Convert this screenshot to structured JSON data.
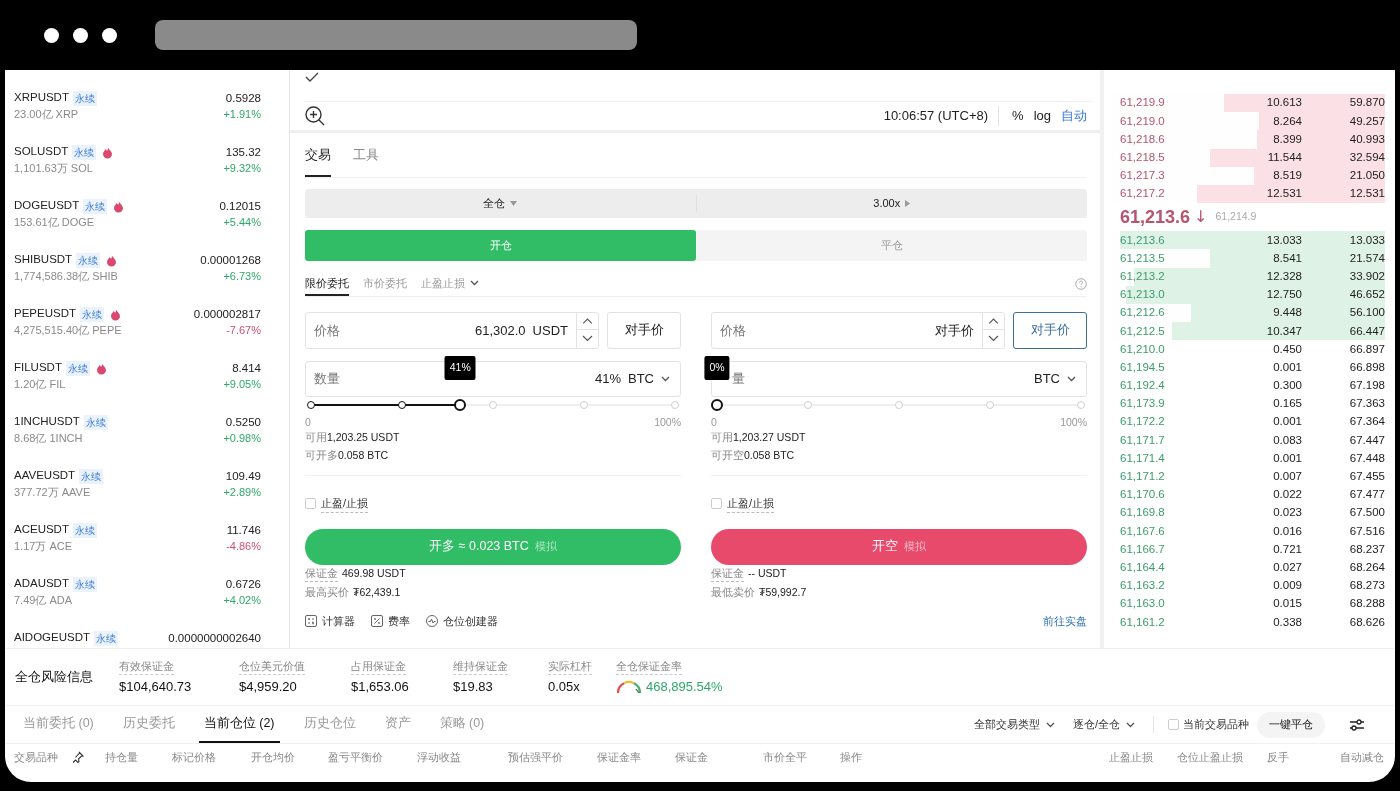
{
  "markets": [
    {
      "symbol": "XRPUSDT",
      "tag": "永续",
      "hot": false,
      "volume": "23.00亿 XRP",
      "price": "0.5928",
      "change": "+1.91%",
      "color": "#2fa86a"
    },
    {
      "symbol": "SOLUSDT",
      "tag": "永续",
      "hot": true,
      "volume": "1,101.63万 SOL",
      "price": "135.32",
      "change": "+9.32%",
      "color": "#2fa86a"
    },
    {
      "symbol": "DOGEUSDT",
      "tag": "永续",
      "hot": true,
      "volume": "153.61亿 DOGE",
      "price": "0.12015",
      "change": "+5.44%",
      "color": "#2fa86a"
    },
    {
      "symbol": "SHIBUSDT",
      "tag": "永续",
      "hot": true,
      "volume": "1,774,586.38亿 SHIB",
      "price": "0.00001268",
      "change": "+6.73%",
      "color": "#2fa86a"
    },
    {
      "symbol": "PEPEUSDT",
      "tag": "永续",
      "hot": true,
      "volume": "4,275,515.40亿 PEPE",
      "price": "0.000002817",
      "change": "-7.67%",
      "color": "#c9506e"
    },
    {
      "symbol": "FILUSDT",
      "tag": "永续",
      "hot": true,
      "volume": "1.20亿 FIL",
      "price": "8.414",
      "change": "+9.05%",
      "color": "#2fa86a"
    },
    {
      "symbol": "1INCHUSDT",
      "tag": "永续",
      "hot": false,
      "volume": "8.68亿 1INCH",
      "price": "0.5250",
      "change": "+0.98%",
      "color": "#2fa86a"
    },
    {
      "symbol": "AAVEUSDT",
      "tag": "永续",
      "hot": false,
      "volume": "377.72万 AAVE",
      "price": "109.49",
      "change": "+2.89%",
      "color": "#2fa86a"
    },
    {
      "symbol": "ACEUSDT",
      "tag": "永续",
      "hot": false,
      "volume": "1.17万 ACE",
      "price": "11.746",
      "change": "-4.86%",
      "color": "#c9506e"
    },
    {
      "symbol": "ADAUSDT",
      "tag": "永续",
      "hot": false,
      "volume": "7.49亿 ADA",
      "price": "0.6726",
      "change": "+4.02%",
      "color": "#2fa86a"
    },
    {
      "symbol": "AIDOGEUSDT",
      "tag": "永续",
      "hot": false,
      "price": "0.0000000002640"
    }
  ],
  "chart_toolbar": {
    "time": "10:06:57 (UTC+8)",
    "scales": [
      {
        "label": "%",
        "selected": false
      },
      {
        "label": "log",
        "selected": false
      },
      {
        "label": "自动",
        "selected": true
      }
    ]
  },
  "trade_tabs": [
    {
      "label": "交易",
      "selected": true
    },
    {
      "label": "工具",
      "selected": false
    }
  ],
  "margin_mode": "全仓",
  "leverage": "3.00x",
  "actions": [
    {
      "label": "开仓",
      "selected": true
    },
    {
      "label": "平仓",
      "selected": false
    }
  ],
  "order_types": [
    {
      "label": "限价委托",
      "selected": true,
      "dropdown": false
    },
    {
      "label": "市价委托",
      "selected": false,
      "dropdown": false
    },
    {
      "label": "止盈止损",
      "selected": false,
      "dropdown": true
    }
  ],
  "sides": [
    {
      "kind": "long",
      "price_label": "价格",
      "price_value": "61,302.0",
      "price_unit": "USDT",
      "counter_button": {
        "label": "对手价",
        "selected": false
      },
      "quantity_label": "数量",
      "quantity_value": "41%",
      "quantity_unit": "BTC",
      "level": 0.41,
      "tooltip": "41%",
      "slider_min": "0",
      "slider_max": "100%",
      "available_label": "可用",
      "available": "1,203.25 USDT",
      "openable_label": "可开多",
      "openable": "0.058 BTC",
      "tp_sl": {
        "label": "止盈/止损",
        "checked": false
      },
      "submit": {
        "label": "开多 ≈ 0.023 BTC",
        "tag": "模拟"
      },
      "margin_label": "保证金",
      "margin": "469.98 USDT",
      "best_label": "最高买价",
      "best": "₮62,439.1"
    },
    {
      "kind": "short",
      "price_label": "价格",
      "price_value": "对手价",
      "counter_button": {
        "label": "对手价",
        "selected": true
      },
      "quantity_label": "量",
      "quantity_unit": "BTC",
      "level": 0,
      "tooltip": "0%",
      "slider_min": "0",
      "slider_max": "100%",
      "available_label": "可用",
      "available": "1,203.27 USDT",
      "openable_label": "可开空",
      "openable": "0.058 BTC",
      "tp_sl": {
        "label": "止盈/止损",
        "checked": false
      },
      "submit": {
        "label": "开空",
        "tag": "模拟"
      },
      "margin_label": "保证金",
      "margin": "-- USDT",
      "best_label": "最低卖价",
      "best": "₮59,992.7"
    }
  ],
  "tools": [
    {
      "kind": "calculator",
      "label": "计算器"
    },
    {
      "kind": "rate",
      "label": "费率"
    },
    {
      "kind": "builder",
      "label": "仓位创建器"
    }
  ],
  "live_link": "前往实盘",
  "orderbook": {
    "asks": [
      {
        "price": "61,219.9",
        "amount": "10.613",
        "total": "59.870",
        "level": 0.59
      },
      {
        "price": "61,219.0",
        "amount": "8.264",
        "total": "49.257",
        "level": 0.46
      },
      {
        "price": "61,218.6",
        "amount": "8.399",
        "total": "40.993",
        "level": 0.47
      },
      {
        "price": "61,218.5",
        "amount": "11.544",
        "total": "32.594",
        "level": 0.64
      },
      {
        "price": "61,217.3",
        "amount": "8.519",
        "total": "21.050",
        "level": 0.48
      },
      {
        "price": "61,217.2",
        "amount": "12.531",
        "total": "12.531",
        "level": 0.69
      }
    ],
    "last_price": {
      "value": "61,213.6",
      "arrow": "↓",
      "mark": "61,214.9"
    },
    "bids": [
      {
        "price": "61,213.6",
        "amount": "13.033",
        "total": "13.033",
        "level": 0.97
      },
      {
        "price": "61,213.5",
        "amount": "8.541",
        "total": "21.574",
        "level": 0.64
      },
      {
        "price": "61,213.2",
        "amount": "12.328",
        "total": "33.902",
        "level": 0.92
      },
      {
        "price": "61,213.0",
        "amount": "12.750",
        "total": "46.652",
        "level": 0.95
      },
      {
        "price": "61,212.6",
        "amount": "9.448",
        "total": "56.100",
        "level": 0.71
      },
      {
        "price": "61,212.5",
        "amount": "10.347",
        "total": "66.447",
        "level": 0.78
      },
      {
        "price": "61,210.0",
        "amount": "0.450",
        "total": "66.897"
      },
      {
        "price": "61,194.5",
        "amount": "0.001",
        "total": "66.898"
      },
      {
        "price": "61,192.4",
        "amount": "0.300",
        "total": "67.198"
      },
      {
        "price": "61,173.9",
        "amount": "0.165",
        "total": "67.363"
      },
      {
        "price": "61,172.2",
        "amount": "0.001",
        "total": "67.364"
      },
      {
        "price": "61,171.7",
        "amount": "0.083",
        "total": "67.447"
      },
      {
        "price": "61,171.4",
        "amount": "0.001",
        "total": "67.448"
      },
      {
        "price": "61,171.2",
        "amount": "0.007",
        "total": "67.455"
      },
      {
        "price": "61,170.6",
        "amount": "0.022",
        "total": "67.477"
      },
      {
        "price": "61,169.8",
        "amount": "0.023",
        "total": "67.500"
      },
      {
        "price": "61,167.6",
        "amount": "0.016",
        "total": "67.516"
      },
      {
        "price": "61,166.7",
        "amount": "0.721",
        "total": "68.237"
      },
      {
        "price": "61,164.4",
        "amount": "0.027",
        "total": "68.264"
      },
      {
        "price": "61,163.2",
        "amount": "0.009",
        "total": "68.273"
      },
      {
        "price": "61,163.0",
        "amount": "0.015",
        "total": "68.288"
      },
      {
        "price": "61,161.2",
        "amount": "0.338",
        "total": "68.626"
      }
    ]
  },
  "risk": {
    "title": "全仓风险信息",
    "metrics": [
      {
        "label": "有效保证金",
        "value": "$104,640.73"
      },
      {
        "label": "仓位美元价值",
        "value": "$4,959.20"
      },
      {
        "label": "占用保证金",
        "value": "$1,653.06"
      },
      {
        "label": "维持保证金",
        "value": "$19.83"
      },
      {
        "label": "实际杠杆",
        "value": "0.05x"
      }
    ],
    "rate": {
      "label": "全仓保证金率",
      "value": "468,895.54%"
    }
  },
  "position_tabs": [
    {
      "label": "当前委托 (0)",
      "selected": false
    },
    {
      "label": "历史委托",
      "selected": false
    },
    {
      "label": "当前仓位 (2)",
      "selected": true
    },
    {
      "label": "历史仓位",
      "selected": false
    },
    {
      "label": "资产",
      "selected": false
    },
    {
      "label": "策略 (0)",
      "selected": false
    }
  ],
  "filters": [
    {
      "kind": "dropdown",
      "label": "全部交易类型"
    },
    {
      "kind": "dropdown",
      "label": "逐仓/全仓"
    },
    {
      "kind": "checkbox",
      "label": "当前交易品种",
      "checked": false
    },
    {
      "kind": "button",
      "label": "一键平仓"
    }
  ],
  "columns": [
    "交易品种",
    "持仓量",
    "标记价格",
    "开仓均价",
    "盈亏平衡价",
    "浮动收益",
    "预估强平价",
    "保证金率",
    "保证金",
    "市价全平",
    "操作",
    "止盈止损",
    "仓位止盈止损",
    "反手",
    "自动减仓"
  ]
}
